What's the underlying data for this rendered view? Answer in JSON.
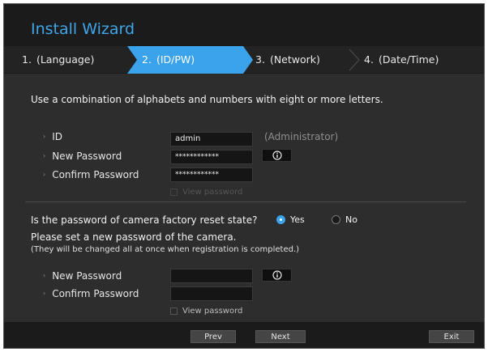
{
  "window": {
    "title": "Install Wizard"
  },
  "steps": [
    {
      "num": "1.",
      "label": "(Language)"
    },
    {
      "num": "2.",
      "label": "(ID/PW)"
    },
    {
      "num": "3.",
      "label": "(Network)"
    },
    {
      "num": "4.",
      "label": "(Date/Time)"
    }
  ],
  "account": {
    "instruction": "Use a combination of alphabets and numbers with eight or more letters.",
    "id_label": "ID",
    "id_value": "admin",
    "id_note": "(Administrator)",
    "new_password_label": "New Password",
    "new_password_value": "************",
    "confirm_password_label": "Confirm Password",
    "confirm_password_value": "************",
    "view_password_label": "View password"
  },
  "camera": {
    "question": "Is the password of camera factory reset state?",
    "yes_label": "Yes",
    "no_label": "No",
    "set_text": "Please set a new password of the camera.",
    "note_text": "(They will be changed all at once when registration is completed.)",
    "new_password_label": "New Password",
    "confirm_password_label": "Confirm Password",
    "view_password_label": "View password"
  },
  "footer": {
    "prev_label": "Prev",
    "next_label": "Next",
    "exit_label": "Exit"
  },
  "colors": {
    "accent": "#3aa3eb",
    "title": "#3fa6ea"
  },
  "icons": {
    "info": "info-icon",
    "step_separator": "chevron-right-icon"
  }
}
